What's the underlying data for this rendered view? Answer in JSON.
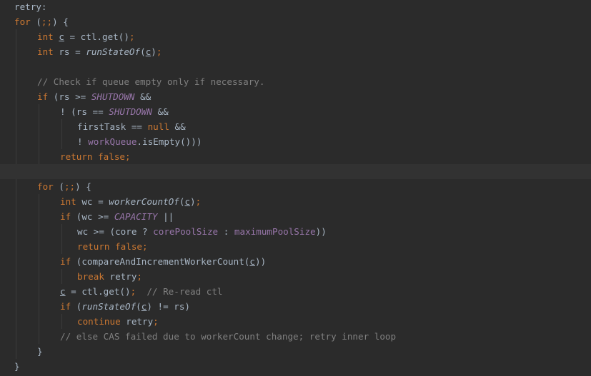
{
  "editor": {
    "colors": {
      "background": "#2b2b2b",
      "current_line": "#323232",
      "keyword": "#cc7832",
      "plain": "#a9b7c6",
      "constant_field": "#9876aa",
      "comment": "#808080"
    },
    "lines": [
      {
        "indent": 0,
        "tokens": [
          {
            "t": "retry:",
            "k": "label"
          }
        ]
      },
      {
        "indent": 0,
        "tokens": [
          {
            "t": "for",
            "k": "kw"
          },
          {
            "t": " (",
            "k": "plain"
          },
          {
            "t": ";;",
            "k": "kw"
          },
          {
            "t": ") {",
            "k": "plain"
          }
        ]
      },
      {
        "indent": 1,
        "tokens": [
          {
            "t": "int ",
            "k": "kw"
          },
          {
            "t": "c",
            "k": "ul"
          },
          {
            "t": " = ctl.get()",
            "k": "plain"
          },
          {
            "t": ";",
            "k": "kw"
          }
        ]
      },
      {
        "indent": 1,
        "tokens": [
          {
            "t": "int ",
            "k": "kw"
          },
          {
            "t": "rs = ",
            "k": "plain"
          },
          {
            "t": "runStateOf",
            "k": "call"
          },
          {
            "t": "(",
            "k": "plain"
          },
          {
            "t": "c",
            "k": "ul"
          },
          {
            "t": ")",
            "k": "plain"
          },
          {
            "t": ";",
            "k": "kw"
          }
        ]
      },
      {
        "indent": 0,
        "tokens": []
      },
      {
        "indent": 1,
        "tokens": [
          {
            "t": "// Check if queue empty only if necessary.",
            "k": "cmt"
          }
        ]
      },
      {
        "indent": 1,
        "tokens": [
          {
            "t": "if ",
            "k": "kw"
          },
          {
            "t": "(rs >= ",
            "k": "plain"
          },
          {
            "t": "SHUTDOWN",
            "k": "const"
          },
          {
            "t": " &&",
            "k": "plain"
          }
        ]
      },
      {
        "indent": 2,
        "tokens": [
          {
            "t": "! (rs == ",
            "k": "plain"
          },
          {
            "t": "SHUTDOWN",
            "k": "const"
          },
          {
            "t": " &&",
            "k": "plain"
          }
        ]
      },
      {
        "indent": 3,
        "tokens": [
          {
            "t": "firstTask == ",
            "k": "plain"
          },
          {
            "t": "null ",
            "k": "kw"
          },
          {
            "t": "&&",
            "k": "plain"
          }
        ]
      },
      {
        "indent": 3,
        "tokens": [
          {
            "t": "! ",
            "k": "plain"
          },
          {
            "t": "workQueue",
            "k": "field"
          },
          {
            "t": ".isEmpty()))",
            "k": "plain"
          }
        ]
      },
      {
        "indent": 2,
        "tokens": [
          {
            "t": "return false;",
            "k": "kw"
          }
        ]
      },
      {
        "indent": 0,
        "tokens": [],
        "current": true
      },
      {
        "indent": 1,
        "tokens": [
          {
            "t": "for ",
            "k": "kw"
          },
          {
            "t": "(",
            "k": "plain"
          },
          {
            "t": ";;",
            "k": "kw"
          },
          {
            "t": ") {",
            "k": "plain"
          }
        ]
      },
      {
        "indent": 2,
        "tokens": [
          {
            "t": "int ",
            "k": "kw"
          },
          {
            "t": "wc = ",
            "k": "plain"
          },
          {
            "t": "workerCountOf",
            "k": "call"
          },
          {
            "t": "(",
            "k": "plain"
          },
          {
            "t": "c",
            "k": "ul"
          },
          {
            "t": ")",
            "k": "plain"
          },
          {
            "t": ";",
            "k": "kw"
          }
        ]
      },
      {
        "indent": 2,
        "tokens": [
          {
            "t": "if ",
            "k": "kw"
          },
          {
            "t": "(wc >= ",
            "k": "plain"
          },
          {
            "t": "CAPACITY",
            "k": "const"
          },
          {
            "t": " ||",
            "k": "plain"
          }
        ]
      },
      {
        "indent": 3,
        "tokens": [
          {
            "t": "wc >= (core ? ",
            "k": "plain"
          },
          {
            "t": "corePoolSize",
            "k": "field"
          },
          {
            "t": " : ",
            "k": "plain"
          },
          {
            "t": "maximumPoolSize",
            "k": "field"
          },
          {
            "t": "))",
            "k": "plain"
          }
        ]
      },
      {
        "indent": 3,
        "tokens": [
          {
            "t": "return false;",
            "k": "kw"
          }
        ]
      },
      {
        "indent": 2,
        "tokens": [
          {
            "t": "if ",
            "k": "kw"
          },
          {
            "t": "(compareAndIncrementWorkerCount(",
            "k": "plain"
          },
          {
            "t": "c",
            "k": "ul"
          },
          {
            "t": "))",
            "k": "plain"
          }
        ]
      },
      {
        "indent": 3,
        "tokens": [
          {
            "t": "break ",
            "k": "kw"
          },
          {
            "t": "retry",
            "k": "plain"
          },
          {
            "t": ";",
            "k": "kw"
          }
        ]
      },
      {
        "indent": 2,
        "tokens": [
          {
            "t": "c",
            "k": "ul"
          },
          {
            "t": " = ctl.get()",
            "k": "plain"
          },
          {
            "t": ";  ",
            "k": "kw"
          },
          {
            "t": "// Re-read ctl",
            "k": "cmt"
          }
        ]
      },
      {
        "indent": 2,
        "tokens": [
          {
            "t": "if ",
            "k": "kw"
          },
          {
            "t": "(",
            "k": "plain"
          },
          {
            "t": "runStateOf",
            "k": "call"
          },
          {
            "t": "(",
            "k": "plain"
          },
          {
            "t": "c",
            "k": "ul"
          },
          {
            "t": ") != rs)",
            "k": "plain"
          }
        ]
      },
      {
        "indent": 3,
        "tokens": [
          {
            "t": "continue ",
            "k": "kw"
          },
          {
            "t": "retry",
            "k": "plain"
          },
          {
            "t": ";",
            "k": "kw"
          }
        ]
      },
      {
        "indent": 2,
        "tokens": [
          {
            "t": "// else CAS failed due to workerCount change; retry inner loop",
            "k": "cmt"
          }
        ]
      },
      {
        "indent": 1,
        "tokens": [
          {
            "t": "}",
            "k": "plain"
          }
        ]
      },
      {
        "indent": 0,
        "tokens": [
          {
            "t": "}",
            "k": "plain"
          }
        ]
      }
    ]
  }
}
